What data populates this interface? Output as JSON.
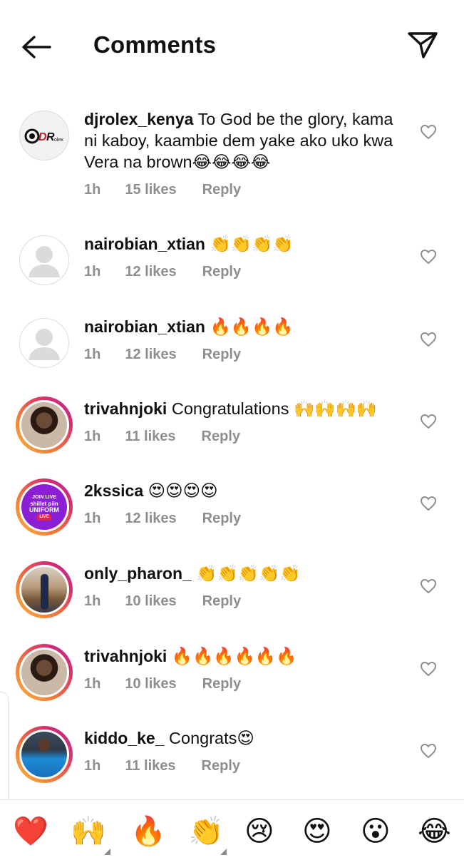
{
  "header": {
    "title": "Comments",
    "back_icon": "arrow-left-icon",
    "share_icon": "paper-plane-icon"
  },
  "comments": [
    {
      "username": "djrolex_kenya",
      "text": "To God be the glory, kama ni kaboy, kaambie dem yake ako uko kwa Vera na brown😂😂😂😂",
      "time": "1h",
      "likes": "15 likes",
      "reply": "Reply",
      "avatar_logo": "DJR"
    },
    {
      "username": "nairobian_xtian",
      "text": "👏👏👏👏",
      "time": "1h",
      "likes": "12 likes",
      "reply": "Reply"
    },
    {
      "username": "nairobian_xtian",
      "text": "🔥🔥🔥🔥",
      "time": "1h",
      "likes": "12 likes",
      "reply": "Reply"
    },
    {
      "username": "trivahnjoki",
      "text": "Congratulations 🙌🙌🙌🙌",
      "time": "1h",
      "likes": "11 likes",
      "reply": "Reply"
    },
    {
      "username": "2kssica",
      "text": "😍😍😍😍",
      "time": "1h",
      "likes": "12 likes",
      "reply": "Reply",
      "avatar_lines": [
        "JOIN LIVE",
        "shillet piin",
        "UNIFORM",
        "LIVE"
      ]
    },
    {
      "username": "only_pharon_",
      "text": "👏👏👏👏👏",
      "time": "1h",
      "likes": "10 likes",
      "reply": "Reply"
    },
    {
      "username": "trivahnjoki",
      "text": "🔥🔥🔥🔥🔥🔥",
      "time": "1h",
      "likes": "10 likes",
      "reply": "Reply"
    },
    {
      "username": "kiddo_ke_",
      "text": "Congrats😍",
      "time": "1h",
      "likes": "11 likes",
      "reply": "Reply"
    }
  ],
  "reactions": [
    "❤️",
    "🙌",
    "🔥",
    "👏",
    "😢",
    "😍",
    "😮",
    "😂"
  ],
  "colors": {
    "meta_grey": "#8e8e8e",
    "story_ring": "#e1306c"
  }
}
